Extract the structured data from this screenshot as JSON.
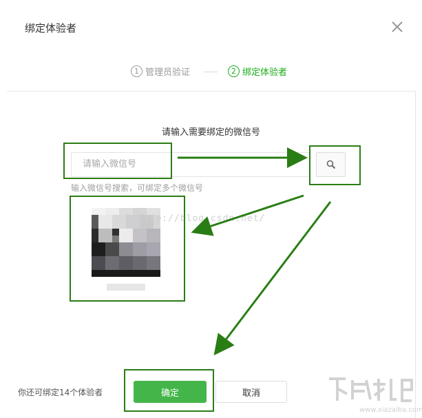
{
  "dialog": {
    "title": "绑定体验者"
  },
  "steps": [
    {
      "num": "1",
      "label": "管理员验证",
      "state": "done"
    },
    {
      "num": "2",
      "label": "绑定体验者",
      "state": "active"
    }
  ],
  "form": {
    "prompt": "请输入需要绑定的微信号",
    "placeholder": "请输入微信号",
    "hint": "输入微信号搜索，可绑定多个微信号"
  },
  "watermark": "http://blog.csdn.net/",
  "footer": {
    "remaining_text": "你还可绑定14个体验者",
    "confirm_label": "确定",
    "cancel_label": "取消"
  },
  "logo": {
    "url": "www.xiazaiba.com"
  },
  "colors": {
    "accent": "#1aad19",
    "confirm_bg": "#44b549",
    "annotation": "#2a7d14"
  },
  "icons": {
    "close": "close-icon",
    "search": "search-icon"
  }
}
